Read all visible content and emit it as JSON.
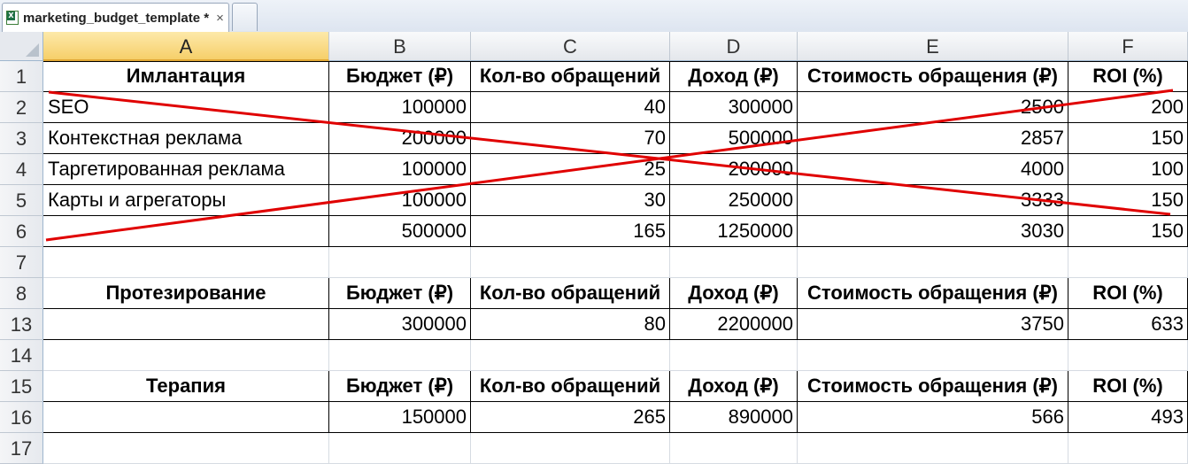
{
  "window": {
    "tab_title": "marketing_budget_template *",
    "close_glyph": "×",
    "file_icon": "excel-file-icon"
  },
  "sheet": {
    "columns": [
      "A",
      "B",
      "C",
      "D",
      "E",
      "F"
    ],
    "selected_column": "A",
    "row_numbers": [
      "1",
      "2",
      "3",
      "4",
      "5",
      "6",
      "7",
      "8",
      "13",
      "14",
      "15",
      "16",
      "17"
    ],
    "rows": [
      {
        "num": "1",
        "kind": "header",
        "label": "Имлантация",
        "cols": [
          "Бюджет (₽)",
          "Кол-во обращений",
          "Доход (₽)",
          "Стоимость обращения (₽)",
          "ROI (%)"
        ]
      },
      {
        "num": "2",
        "kind": "data",
        "label": "SEO",
        "cols": [
          "100000",
          "40",
          "300000",
          "2500",
          "200"
        ]
      },
      {
        "num": "3",
        "kind": "data",
        "label": "Контекстная реклама",
        "cols": [
          "200000",
          "70",
          "500000",
          "2857",
          "150"
        ]
      },
      {
        "num": "4",
        "kind": "data",
        "label": "Таргетированная реклама",
        "cols": [
          "100000",
          "25",
          "200000",
          "4000",
          "100"
        ]
      },
      {
        "num": "5",
        "kind": "data",
        "label": "Карты и агрегаторы",
        "cols": [
          "100000",
          "30",
          "250000",
          "3333",
          "150"
        ]
      },
      {
        "num": "6",
        "kind": "data",
        "label": "",
        "cols": [
          "500000",
          "165",
          "1250000",
          "3030",
          "150"
        ]
      },
      {
        "num": "7",
        "kind": "empty",
        "label": "",
        "cols": [
          "",
          "",
          "",
          "",
          ""
        ]
      },
      {
        "num": "8",
        "kind": "header",
        "label": "Протезирование",
        "cols": [
          "Бюджет (₽)",
          "Кол-во обращений",
          "Доход (₽)",
          "Стоимость обращения (₽)",
          "ROI (%)"
        ]
      },
      {
        "num": "13",
        "kind": "data",
        "label": "",
        "cols": [
          "300000",
          "80",
          "2200000",
          "3750",
          "633"
        ]
      },
      {
        "num": "14",
        "kind": "empty",
        "label": "",
        "cols": [
          "",
          "",
          "",
          "",
          ""
        ]
      },
      {
        "num": "15",
        "kind": "header",
        "label": "Терапия",
        "cols": [
          "Бюджет (₽)",
          "Кол-во обращений",
          "Доход (₽)",
          "Стоимость обращения (₽)",
          "ROI (%)"
        ]
      },
      {
        "num": "16",
        "kind": "data",
        "label": "",
        "cols": [
          "150000",
          "265",
          "890000",
          "566",
          "493"
        ]
      },
      {
        "num": "17",
        "kind": "empty",
        "label": "",
        "cols": [
          "",
          "",
          "",
          "",
          ""
        ]
      }
    ]
  },
  "annotation": {
    "cross_color": "#e00000",
    "covers_rows": [
      "1",
      "6"
    ]
  }
}
